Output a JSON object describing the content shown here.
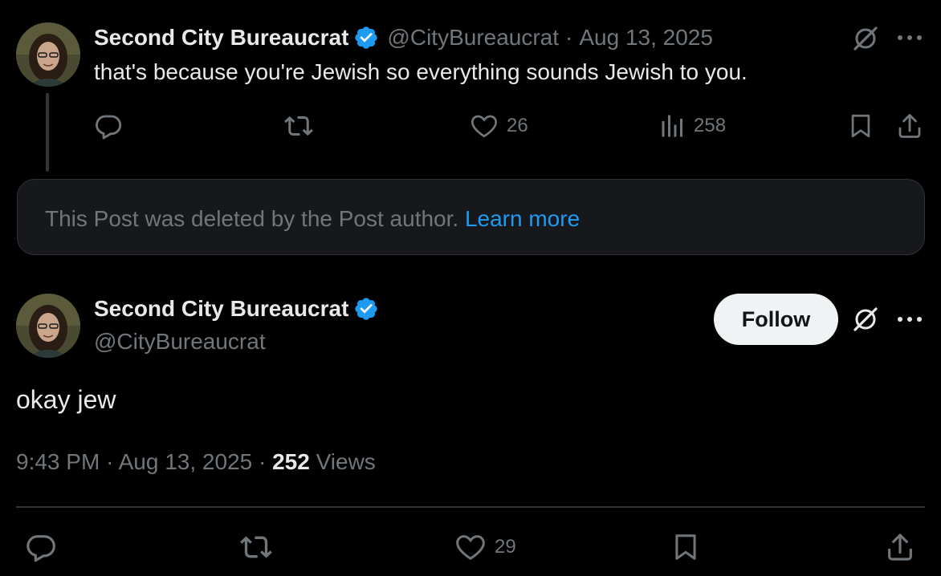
{
  "parent_post": {
    "display_name": "Second City Bureaucrat",
    "handle": "@CityBureaucrat",
    "separator": "·",
    "date": "Aug 13, 2025",
    "text": "that's because you're Jewish so everything sounds Jewish to you.",
    "likes": "26",
    "views": "258"
  },
  "deleted_notice": {
    "text": "This Post was deleted by the Post author.",
    "link": "Learn more"
  },
  "main_post": {
    "display_name": "Second City Bureaucrat",
    "handle": "@CityBureaucrat",
    "follow_label": "Follow",
    "text": "okay jew",
    "time": "9:43 PM",
    "separator1": "·",
    "date": "Aug 13, 2025",
    "separator2": "·",
    "views_count": "252",
    "views_label": "Views",
    "likes": "29"
  },
  "icons": {
    "reply": "reply-icon",
    "repost": "repost-icon",
    "like": "heart-icon",
    "views": "views-icon",
    "bookmark": "bookmark-icon",
    "share": "share-icon",
    "grok": "grok-icon",
    "more": "more-icon",
    "verified": "verified-badge-icon"
  },
  "colors": {
    "background": "#000000",
    "text_primary": "#e7e9ea",
    "text_secondary": "#71767b",
    "accent": "#1d9bf0",
    "follow_bg": "#eff3f4",
    "border": "#2f3336"
  }
}
